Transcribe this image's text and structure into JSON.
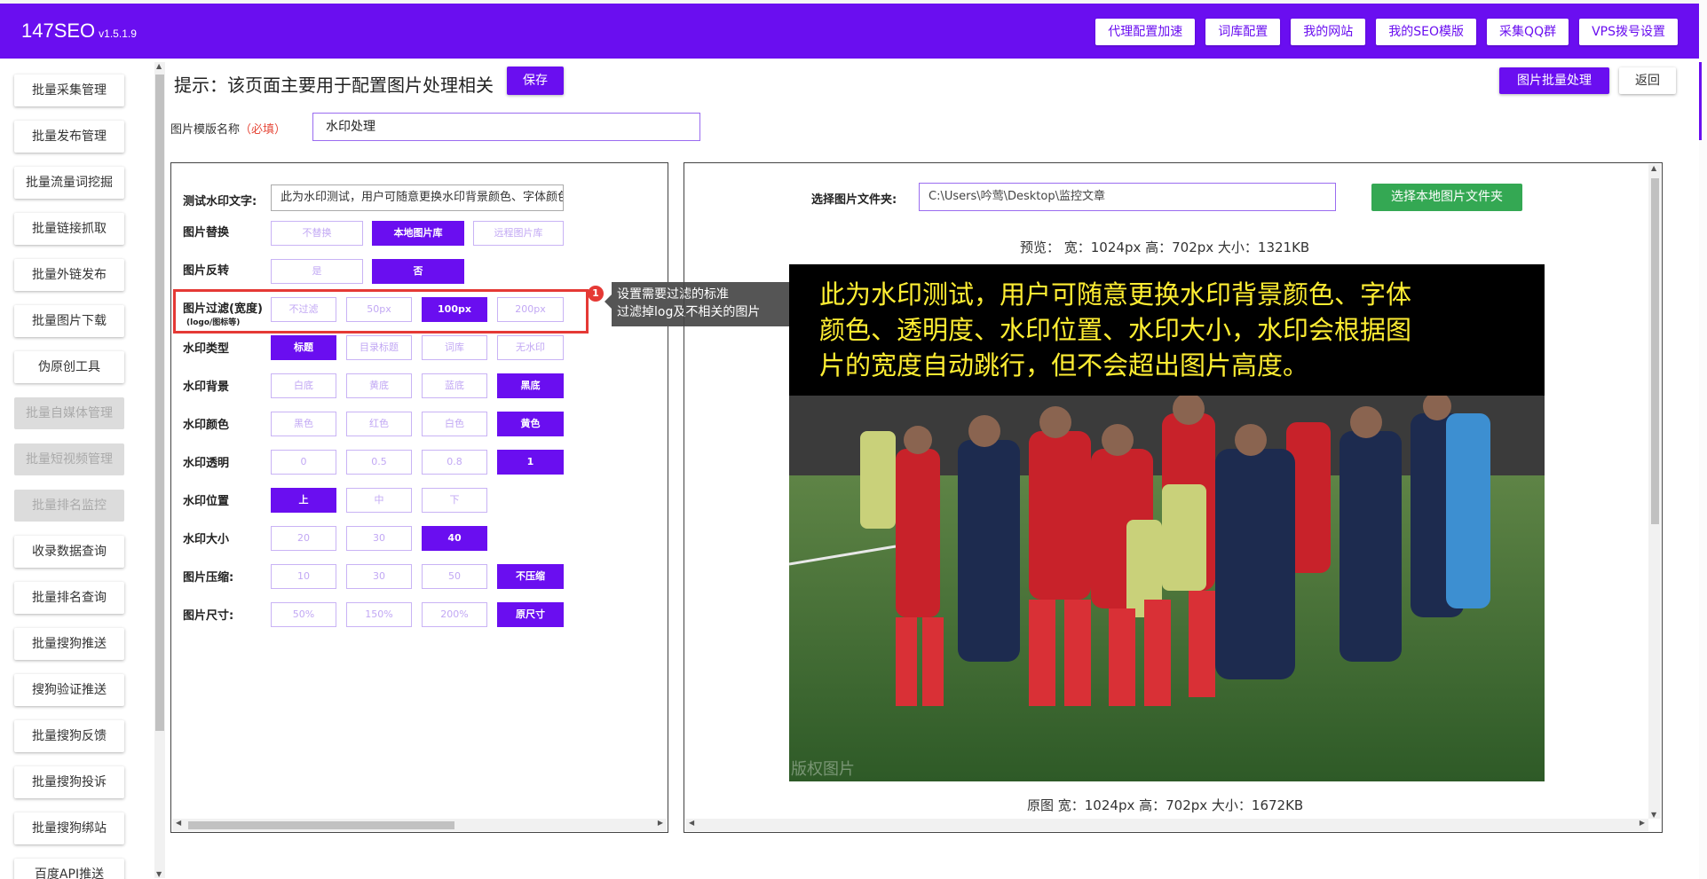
{
  "app": {
    "name": "147SEO",
    "version": "v1.5.1.9"
  },
  "nav": [
    "代理配置加速",
    "词库配置",
    "我的网站",
    "我的SEO模版",
    "采集QQ群",
    "VPS拨号设置"
  ],
  "sidebar": [
    {
      "label": "批量采集管理",
      "disabled": false
    },
    {
      "label": "批量发布管理",
      "disabled": false
    },
    {
      "label": "批量流量词挖掘",
      "disabled": false
    },
    {
      "label": "批量链接抓取",
      "disabled": false
    },
    {
      "label": "批量外链发布",
      "disabled": false
    },
    {
      "label": "批量图片下载",
      "disabled": false
    },
    {
      "label": "伪原创工具",
      "disabled": false
    },
    {
      "label": "批量自媒体管理",
      "disabled": true
    },
    {
      "label": "批量短视频管理",
      "disabled": true
    },
    {
      "label": "批量排名监控",
      "disabled": true
    },
    {
      "label": "收录数据查询",
      "disabled": false
    },
    {
      "label": "批量排名查询",
      "disabled": false
    },
    {
      "label": "批量搜狗推送",
      "disabled": false
    },
    {
      "label": "搜狗验证推送",
      "disabled": false
    },
    {
      "label": "批量搜狗反馈",
      "disabled": false
    },
    {
      "label": "批量搜狗投诉",
      "disabled": false
    },
    {
      "label": "批量搜狗绑站",
      "disabled": false
    },
    {
      "label": "百度API推送",
      "disabled": false
    }
  ],
  "header": {
    "tip": "提示：该页面主要用于配置图片处理相关",
    "save": "保存",
    "batch": "图片批量处理",
    "back": "返回"
  },
  "template": {
    "label": "图片模版名称",
    "required": "（必填）",
    "value": "水印处理"
  },
  "settings": {
    "test_label": "测试水印文字:",
    "test_value": "此为水印测试，用户可随意更换水印背景颜色、字体颜色、透明度、水印位置、水印大小，水印会根据图片的宽度自动跳行，但不会超出图片高度。",
    "rows": [
      {
        "label": "图片替换",
        "options": [
          "不替换",
          "本地图片库",
          "远程图片库"
        ],
        "selected": 1
      },
      {
        "label": "图片反转",
        "options": [
          "是",
          "否"
        ],
        "selected": 1
      },
      {
        "label": "图片过滤(宽度)",
        "sub": "(logo/图标等)",
        "options": [
          "不过滤",
          "50px",
          "100px",
          "200px"
        ],
        "selected": 2
      },
      {
        "label": "水印类型",
        "options": [
          "标题",
          "目录标题",
          "词库",
          "无水印"
        ],
        "selected": 0
      },
      {
        "label": "水印背景",
        "options": [
          "白底",
          "黄底",
          "蓝底",
          "黑底"
        ],
        "selected": 3
      },
      {
        "label": "水印颜色",
        "options": [
          "黑色",
          "红色",
          "白色",
          "黄色"
        ],
        "selected": 3
      },
      {
        "label": "水印透明",
        "options": [
          "0",
          "0.5",
          "0.8",
          "1"
        ],
        "selected": 3
      },
      {
        "label": "水印位置",
        "options": [
          "上",
          "中",
          "下"
        ],
        "selected": 0
      },
      {
        "label": "水印大小",
        "options": [
          "20",
          "30",
          "40"
        ],
        "selected": 2
      },
      {
        "label": "图片压缩:",
        "options": [
          "10",
          "30",
          "50",
          "不压缩"
        ],
        "selected": 3
      },
      {
        "label": "图片尺寸:",
        "options": [
          "50%",
          "150%",
          "200%",
          "原尺寸"
        ],
        "selected": 3
      }
    ]
  },
  "tooltip": {
    "badge": "1",
    "line1": "设置需要过滤的标准",
    "line2": "过滤掉log及不相关的图片"
  },
  "preview": {
    "folder_label": "选择图片文件夹:",
    "folder_value": "C:\\Users\\吟莺\\Desktop\\监控文章",
    "choose_button": "选择本地图片文件夹",
    "preview_info": "预览： 宽：1024px 高：702px 大小：1321KB",
    "watermark_lines": [
      "此为水印测试，用户可随意更换水印背景颜色、字体",
      "颜色、透明度、水印位置、水印大小，水印会根据图",
      "片的宽度自动跳行，但不会超出图片高度。"
    ],
    "copyright_text": "版权图片",
    "original_info": "原图 宽：1024px 高：702px 大小：1672KB"
  },
  "colors": {
    "brand": "#6a0ef0",
    "green": "#34a853",
    "highlight": "#e53935",
    "watermark_text": "#ffee33"
  }
}
